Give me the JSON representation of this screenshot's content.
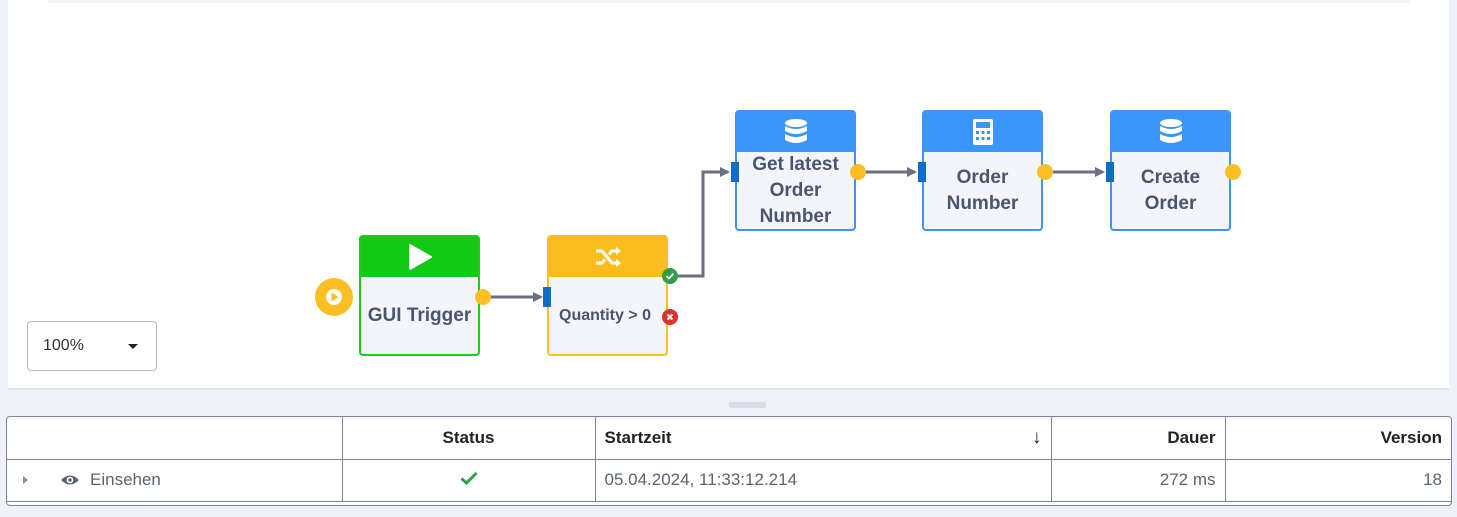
{
  "colors": {
    "trigger": "#13c913",
    "condition": "#fbbd1d",
    "action": "#3b96fb",
    "port": "#fbbf24",
    "connector": "#6b6f86",
    "success": "#2f9e44",
    "failure": "#e03131"
  },
  "flow": {
    "nodes": [
      {
        "id": "gui-trigger",
        "label": "GUI Trigger",
        "icon": "play-icon"
      },
      {
        "id": "quantity-check",
        "label": "Quantity > 0",
        "icon": "shuffle-icon"
      },
      {
        "id": "get-latest-order-number",
        "label": "Get latest Order Number",
        "icon": "database-icon"
      },
      {
        "id": "order-number",
        "label": "Order Number",
        "icon": "calculator-icon"
      },
      {
        "id": "create-order",
        "label": "Create Order",
        "icon": "database-icon"
      }
    ]
  },
  "zoom": {
    "value": "100%"
  },
  "table": {
    "columns": {
      "status": "Status",
      "start": "Startzeit",
      "duration": "Dauer",
      "version": "Version"
    },
    "sort_indicator": "↓",
    "rows": [
      {
        "action": "Einsehen",
        "status_icon": "check-icon",
        "start": "05.04.2024, 11:33:12.214",
        "duration": "272 ms",
        "version": "18"
      }
    ]
  }
}
